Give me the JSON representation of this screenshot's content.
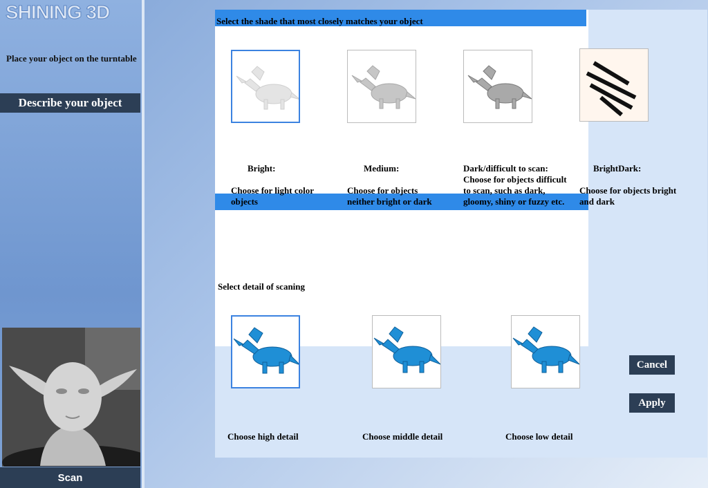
{
  "app": {
    "logo": "SHINING 3D"
  },
  "sidebar": {
    "instruction": "Place your object on the turntable",
    "describe_label": "Describe your object",
    "scan_label": "Scan"
  },
  "dialog": {
    "shade_header": "Select the shade that most closely matches your object",
    "shades": [
      {
        "title": "Bright:",
        "desc": "Choose for light color objects"
      },
      {
        "title": "Medium:",
        "desc": "Choose for objects neither bright or dark"
      },
      {
        "title": "Dark/difficult to scan:",
        "desc": "Choose for objects difficult to scan, such as dark, gloomy, shiny or fuzzy etc."
      },
      {
        "title": "BrightDark:",
        "desc": "Choose for objects bright and dark"
      }
    ],
    "detail_header": "Select detail of scaning",
    "details": [
      {
        "label": "Choose high detail"
      },
      {
        "label": "Choose middle detail"
      },
      {
        "label": "Choose low detail"
      }
    ],
    "cancel_label": "Cancel",
    "apply_label": "Apply"
  },
  "colors": {
    "accent_blue": "#2f8ae8",
    "dark_button": "#2c3e55",
    "dialog_bg": "#d6e5f8",
    "model_blue": "#1f8fd6"
  }
}
